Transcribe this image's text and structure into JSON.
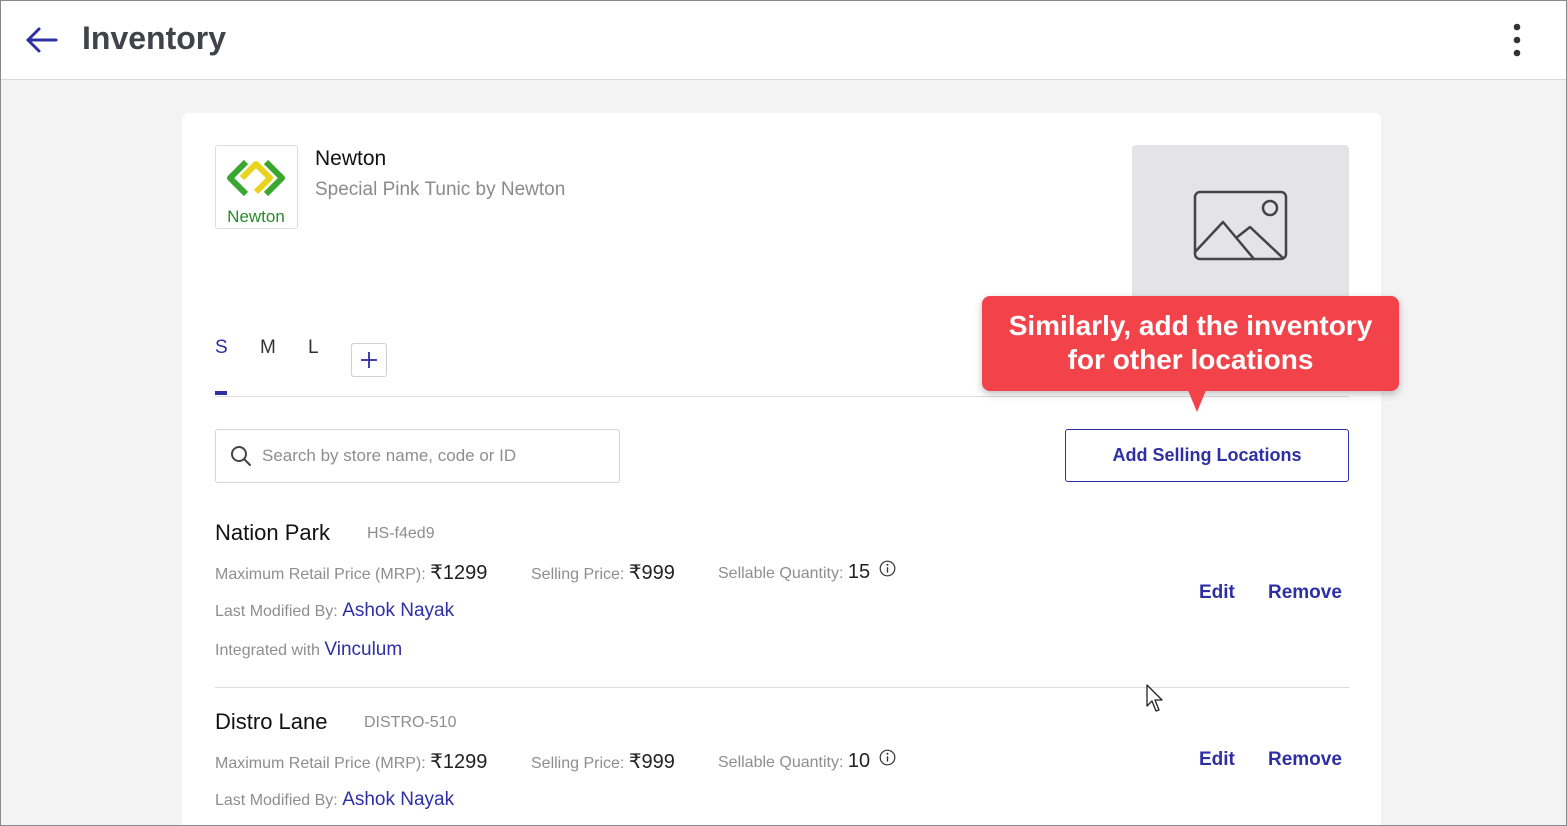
{
  "header": {
    "title": "Inventory",
    "back_icon": "arrow-left-icon",
    "menu_icon": "more-vertical-icon"
  },
  "product": {
    "brand": "Newton",
    "name": "Special Pink Tunic by Newton",
    "logo_text": "Newton",
    "image_icon": "image-placeholder-icon"
  },
  "size_tabs": {
    "items": [
      "S",
      "M",
      "L"
    ],
    "active": "S",
    "add_icon": "plus-icon"
  },
  "search": {
    "placeholder": "Search by store name, code or ID",
    "value": ""
  },
  "add_locations_label": "Add Selling Locations",
  "callout": {
    "line1": "Similarly, add the inventory",
    "line2": "for other locations"
  },
  "labels": {
    "mrp": "Maximum Retail Price (MRP):",
    "selling_price": "Selling Price:",
    "sellable_qty": "Sellable Quantity:",
    "last_modified": "Last Modified By:",
    "integrated_with": "Integrated with",
    "edit": "Edit",
    "remove": "Remove"
  },
  "locations": [
    {
      "name": "Nation Park",
      "code": "HS-f4ed9",
      "mrp": "₹1299",
      "selling_price": "₹999",
      "sellable_qty": "15",
      "modified_by": "Ashok Nayak",
      "integration": "Vinculum"
    },
    {
      "name": "Distro Lane",
      "code": "DISTRO-510",
      "mrp": "₹1299",
      "selling_price": "₹999",
      "sellable_qty": "10",
      "modified_by": "Ashok Nayak"
    }
  ],
  "colors": {
    "accent": "#2e2fa5",
    "callout": "#f2434b",
    "muted": "#8e8e8e",
    "logo_green": "#3aa82f",
    "logo_yellow": "#e8d41c"
  }
}
